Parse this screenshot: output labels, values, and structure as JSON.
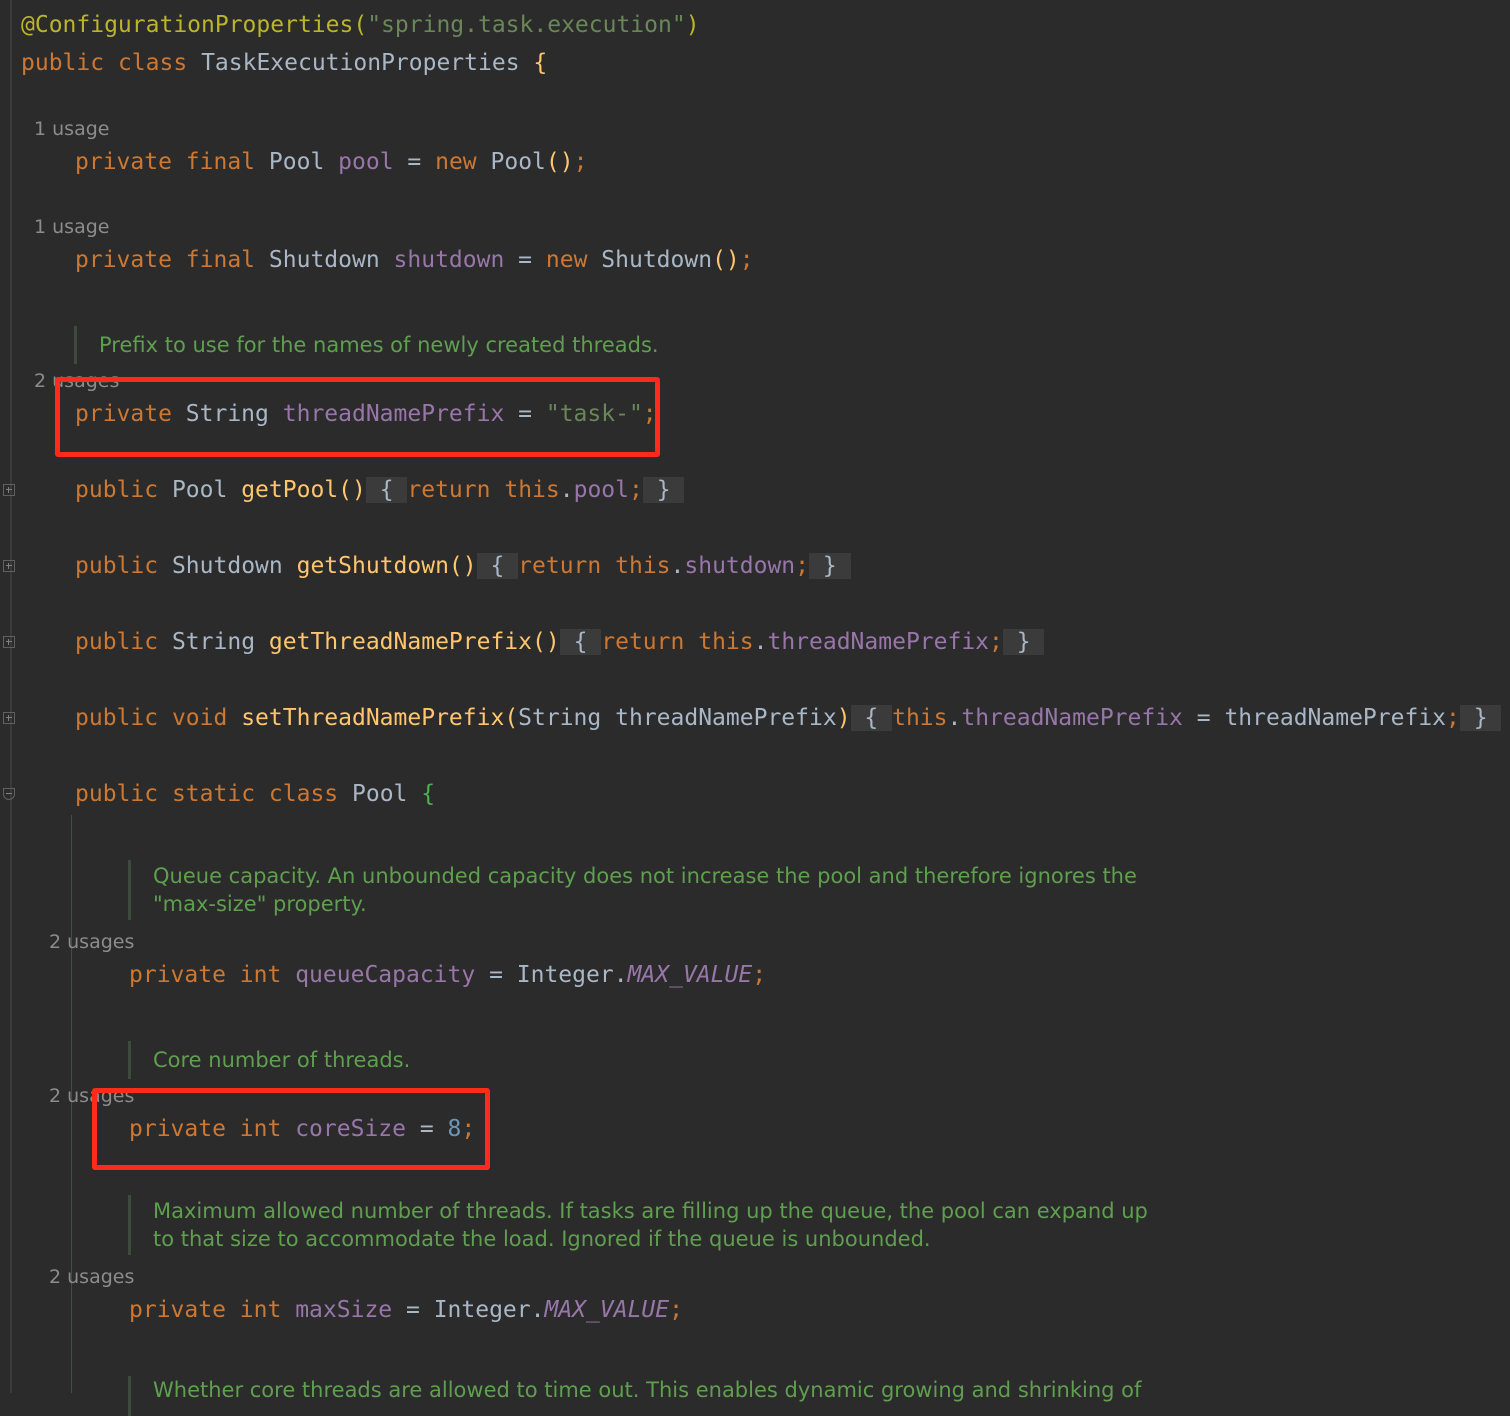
{
  "header": {
    "annotation": "@ConfigurationProperties",
    "annotation_arg": "\"spring.task.execution\"",
    "kw_public": "public",
    "kw_class": "class",
    "class_name": "TaskExecutionProperties",
    "brace": "{"
  },
  "usages": {
    "one": "1 usage",
    "two": "2 usages"
  },
  "kw": {
    "private": "private",
    "final": "final",
    "new": "new",
    "public": "public",
    "return": "return",
    "this": "this",
    "void": "void",
    "static": "static",
    "class": "class",
    "int": "int"
  },
  "types": {
    "Pool": "Pool",
    "Shutdown": "Shutdown",
    "String": "String",
    "Integer": "Integer"
  },
  "fields": {
    "pool": "pool",
    "shutdown": "shutdown",
    "threadNamePrefix": "threadNamePrefix",
    "queueCapacity": "queueCapacity",
    "coreSize": "coreSize",
    "maxSize": "maxSize"
  },
  "methods": {
    "getPool": "getPool",
    "getShutdown": "getShutdown",
    "getThreadNamePrefix": "getThreadNamePrefix",
    "setThreadNamePrefix": "setThreadNamePrefix"
  },
  "literals": {
    "task_prefix": "\"task-\"",
    "core_size": "8",
    "max_value": "MAX_VALUE"
  },
  "docs": {
    "thread_prefix": "Prefix to use for the names of newly created threads.",
    "queue_capacity_1": "Queue capacity. An unbounded capacity does not increase the pool and therefore ignores the",
    "queue_capacity_2": "\"max-size\" property.",
    "core_threads": "Core number of threads.",
    "max_size_1": "Maximum allowed number of threads. If tasks are filling up the queue, the pool can expand up",
    "max_size_2": "to that size to accommodate the load. Ignored if the queue is unbounded.",
    "core_timeout_partial": "Whether core threads are allowed to time out. This enables dynamic growing and shrinking of"
  },
  "highlight_color": "#ff2a1a"
}
